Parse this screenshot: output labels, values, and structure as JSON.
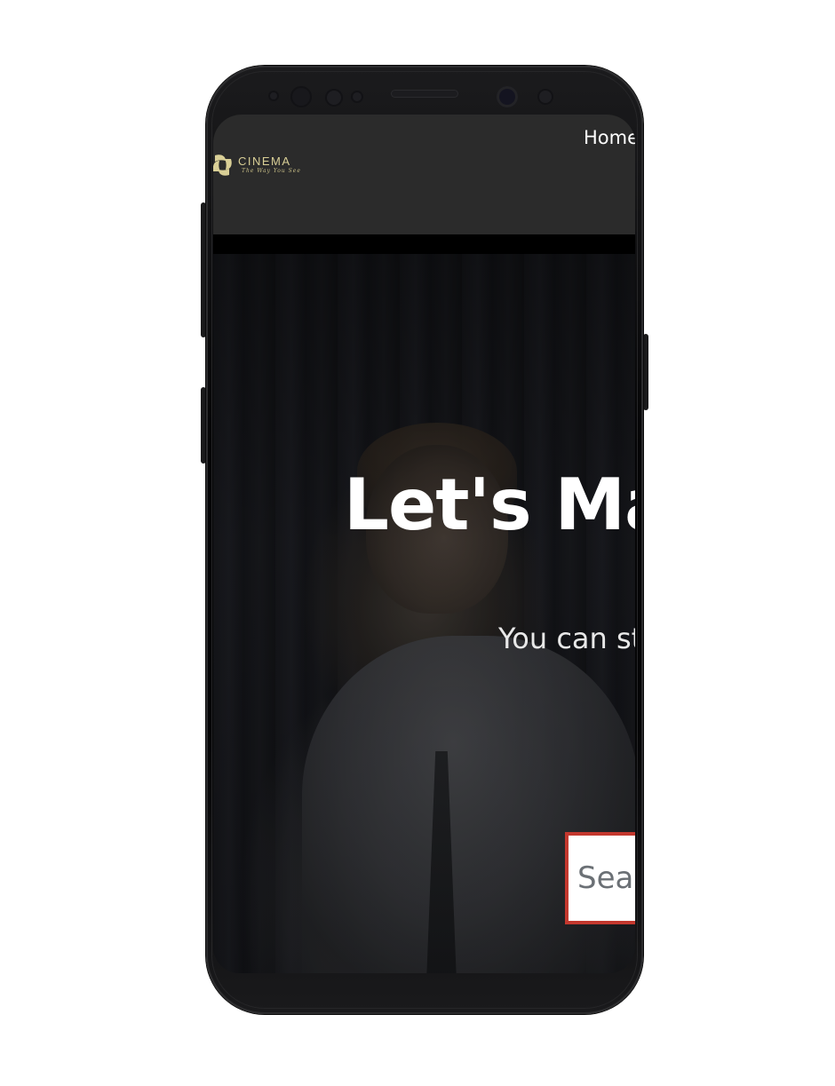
{
  "colors": {
    "header_bg": "#2b2b2b",
    "logo_gold": "#d9cf96",
    "search_border": "#c3382e",
    "hero_text": "#ffffff"
  },
  "header": {
    "logo": {
      "name": "CINEMA",
      "tagline": "The Way You See",
      "icon": "cinema-logo-icon"
    },
    "nav": {
      "home_label": "Home"
    }
  },
  "hero": {
    "title": "Let's Mal",
    "subtitle": "You can sti",
    "search": {
      "placeholder": "Searc"
    }
  }
}
